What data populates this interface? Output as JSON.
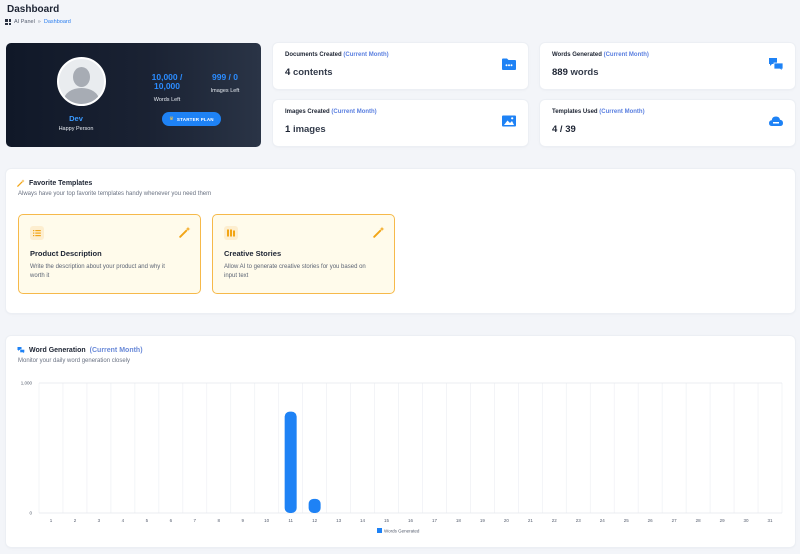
{
  "header": {
    "title": "Dashboard",
    "breadcrumb": {
      "root": "AI Panel",
      "separator": "»",
      "current": "Dashboard"
    }
  },
  "profile": {
    "name": "Dev",
    "role": "Happy Person",
    "words_value": "10,000 / 10,000",
    "words_value_line1": "10,000 /",
    "words_value_line2": "10,000",
    "words_label": "Words Left",
    "images_value": "999 / 0",
    "images_label": "Images Left",
    "plan_label": "STARTER PLAN"
  },
  "stats": [
    {
      "title": "Documents Created",
      "period": "(Current Month)",
      "value_num": "4",
      "value_unit": "contents",
      "icon": "folder-icon"
    },
    {
      "title": "Words Generated",
      "period": "(Current Month)",
      "value_num": "889",
      "value_unit": "words",
      "icon": "chat-bubbles-icon"
    },
    {
      "title": "Images Created",
      "period": "(Current Month)",
      "value_num": "1",
      "value_unit": "images",
      "icon": "image-icon"
    },
    {
      "title": "Templates Used",
      "period": "(Current Month)",
      "value_num": "4 / 39",
      "value_unit": "",
      "icon": "cloud-icon"
    }
  ],
  "favorites": {
    "title": "Favorite Templates",
    "subtitle": "Always have your top favorite templates handy whenever you need them",
    "items": [
      {
        "title": "Product Description",
        "description": "Write the description about your product and why it worth it",
        "icon": "list-icon"
      },
      {
        "title": "Creative Stories",
        "description": "Allow AI to generate creative stories for you based on input text",
        "icon": "book-icon"
      }
    ]
  },
  "word_generation": {
    "title": "Word Generation",
    "period": "(Current Month)",
    "subtitle": "Monitor your daily word generation closely"
  },
  "colors": {
    "accent": "#1e82f5",
    "template_border": "#f6b94a",
    "template_bg": "#fffbeb",
    "profile_bg": "#141c2b"
  },
  "chart_data": {
    "type": "bar",
    "categories": [
      "1",
      "2",
      "3",
      "4",
      "5",
      "6",
      "7",
      "8",
      "9",
      "10",
      "11",
      "12",
      "13",
      "14",
      "15",
      "16",
      "17",
      "18",
      "19",
      "20",
      "21",
      "22",
      "23",
      "24",
      "25",
      "26",
      "27",
      "28",
      "29",
      "30",
      "31"
    ],
    "series": [
      {
        "name": "Words Generated",
        "values": [
          0,
          0,
          0,
          0,
          0,
          0,
          0,
          0,
          0,
          0,
          780,
          109,
          0,
          0,
          0,
          0,
          0,
          0,
          0,
          0,
          0,
          0,
          0,
          0,
          0,
          0,
          0,
          0,
          0,
          0,
          0
        ]
      }
    ],
    "y_tick_labels": [
      "1,000",
      "0"
    ],
    "ylim": [
      0,
      1000
    ],
    "grid": true,
    "legend": "bottom",
    "color": "#1e82f5"
  }
}
